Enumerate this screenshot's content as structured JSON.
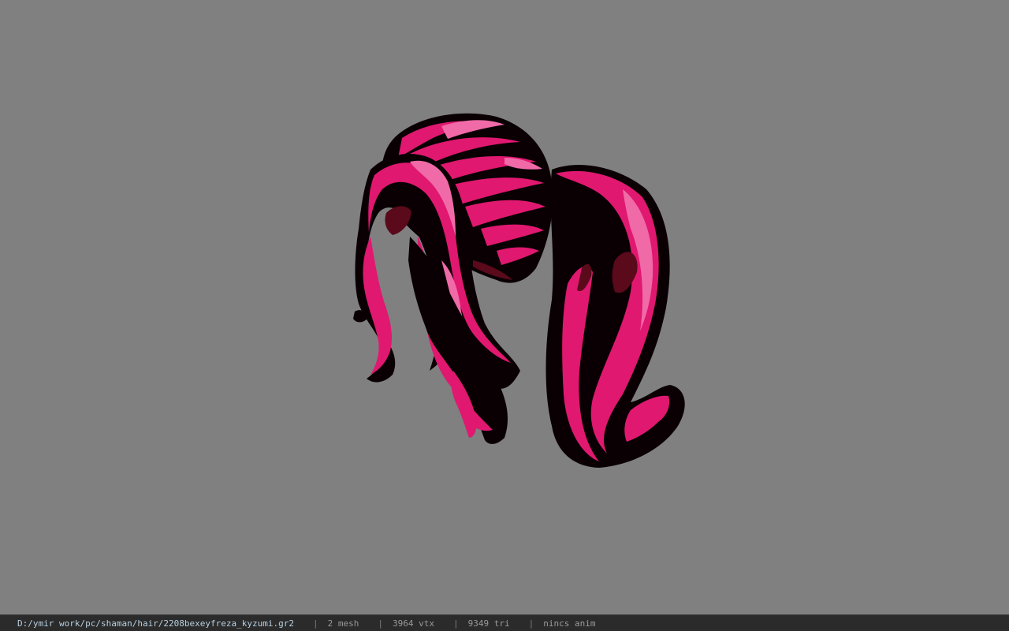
{
  "status": {
    "file_path": "D:/ymir work/pc/shaman/hair/2208bexeyfreza_kyzumi.gr2",
    "separator": "|",
    "mesh": "2 mesh",
    "vertices": "3964 vtx",
    "triangles": "9349 tri",
    "anim": "nincs anim"
  },
  "colors": {
    "background": "#808080",
    "hair_pink": "#e0186f",
    "hair_highlight": "#f06aa8",
    "hair_dark": "#0a0004",
    "hair_shadow": "#5a0a1a"
  }
}
